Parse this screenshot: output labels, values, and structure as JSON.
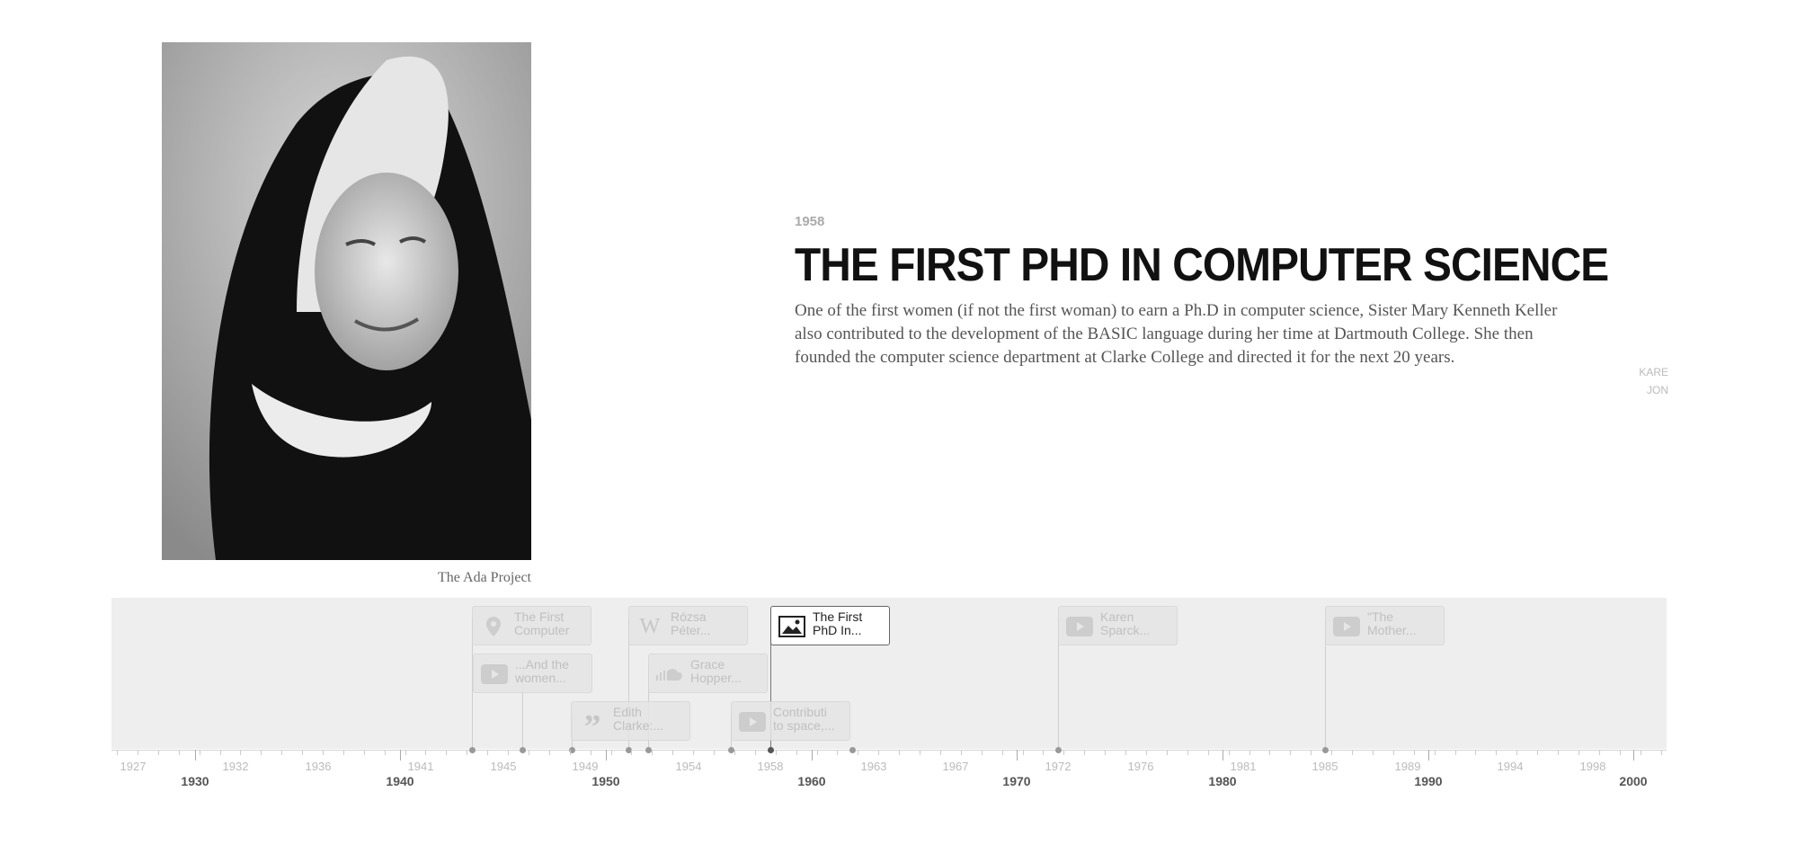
{
  "slide": {
    "date": "1958",
    "headline": "THE FIRST PHD IN COMPUTER SCIENCE",
    "body": "One of the first women (if not the first woman) to earn a Ph.D in computer science, Sister Mary Kenneth Keller also contributed to the development of the BASIC language during her time at Dartmouth College. She then founded the computer science department at Clarke College and directed it for the next 20 years.",
    "media_credit": "The Ada Project",
    "next_peek": "KARE\nJON"
  },
  "timeline": {
    "markers": [
      {
        "label": "The First\nComputer",
        "icon": "map-pin-icon",
        "active": false
      },
      {
        "label": "...And the\nwomen...",
        "icon": "video-icon",
        "active": false
      },
      {
        "label": "Edith\nClarke:...",
        "icon": "quote-icon",
        "active": false
      },
      {
        "label": "Rózsa\nPéter...",
        "icon": "wikipedia-icon",
        "active": false
      },
      {
        "label": "Grace\nHopper...",
        "icon": "soundcloud-icon",
        "active": false
      },
      {
        "label": "Contributi\nto space,...",
        "icon": "video-icon",
        "active": false
      },
      {
        "label": "The First\nPhD In...",
        "icon": "image-icon",
        "active": true
      },
      {
        "label": "Karen\nSparck...",
        "icon": "video-icon",
        "active": false
      },
      {
        "label": "\"The\nMother...",
        "icon": "video-icon",
        "active": false
      }
    ],
    "minor_labels": [
      "1927",
      "1932",
      "1936",
      "1941",
      "1945",
      "1949",
      "1954",
      "1958",
      "1963",
      "1967",
      "1972",
      "1976",
      "1981",
      "1985",
      "1989",
      "1994",
      "1998"
    ],
    "major_labels": [
      "1930",
      "1940",
      "1950",
      "1960",
      "1970",
      "1980",
      "1990",
      "2000"
    ]
  },
  "colors": {
    "background": "#ffffff",
    "timeline_bg": "#eeeeee",
    "headline": "#111111",
    "body": "#555555"
  }
}
